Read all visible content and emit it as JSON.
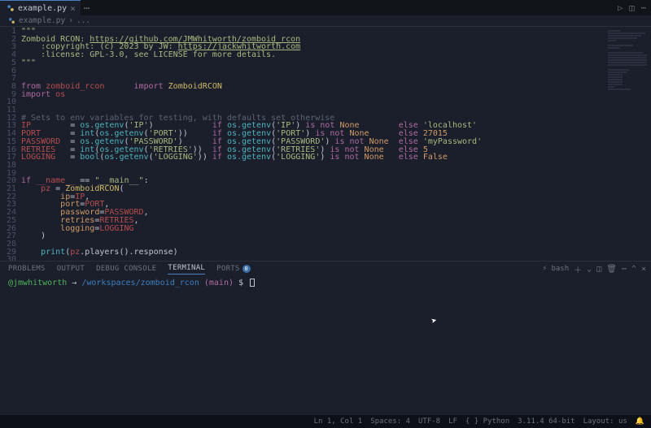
{
  "tab": {
    "filename": "example.py"
  },
  "breadcrumb": {
    "item": "example.py",
    "sep": "..."
  },
  "code": {
    "lines": 30,
    "l1": "\"\"\"",
    "l2a": "Zomboid RCON: ",
    "l2b": "https://github.com/JMWhitworth/zomboid_rcon",
    "l3a": "    :copyright: (c) 2023 by JW: ",
    "l3b": "https://jackwhitworth.com",
    "l4": "    :license: GPL-3.0, see LICENSE for more details.",
    "l5": "\"\"\"",
    "l8_from": "from",
    "l8_mod": "zomboid_rcon",
    "l8_imp": "import",
    "l8_cls": "ZomboidRCON",
    "l9_imp": "import",
    "l9_mod": "os",
    "l12": "# Sets to env variables for testing, with defaults set otherwise",
    "ip": "IP",
    "port": "PORT",
    "pwd": "PASSWORD",
    "ret": "RETRIES",
    "log": "LOGGING",
    "getenv": "os.getenv",
    "int": "int",
    "bool": "bool",
    "if": "if",
    "isnot": "is not",
    "none": "None",
    "else": "else",
    "v_ip": "'IP'",
    "v_port": "'PORT'",
    "v_pwd": "'PASSWORD'",
    "v_ret": "'RETRIES'",
    "v_log": "'LOGGING'",
    "d_ip": "'localhost'",
    "d_port": "27015",
    "d_pwd": "'myPassword'",
    "d_ret": "5",
    "d_log": "False",
    "name": "__name__",
    "main": "\"__main__\"",
    "pz": "pz",
    "eq": "=",
    "cls": "ZomboidRCON",
    "p_ip": "ip",
    "p_port": "port",
    "p_pwd": "password",
    "p_ret": "retries",
    "p_log": "logging",
    "print": "print",
    "players": ".players().response"
  },
  "panel": {
    "tabs": {
      "problems": "PROBLEMS",
      "output": "OUTPUT",
      "debug": "DEBUG CONSOLE",
      "terminal": "TERMINAL",
      "ports": "PORTS"
    },
    "ports_badge": "0",
    "shell": "bash",
    "prompt": {
      "user": "@jmwhitworth",
      "arrow": "→",
      "path": "/workspaces/zomboid_rcon",
      "branch": "(main)",
      "dollar": "$"
    }
  },
  "status": {
    "ln": "Ln 1, Col 1",
    "spaces": "Spaces: 4",
    "enc": "UTF-8",
    "eol": "LF",
    "lang": "Python",
    "py": "3.11.4 64-bit",
    "layout": "Layout: us",
    "bell": "🔔"
  }
}
